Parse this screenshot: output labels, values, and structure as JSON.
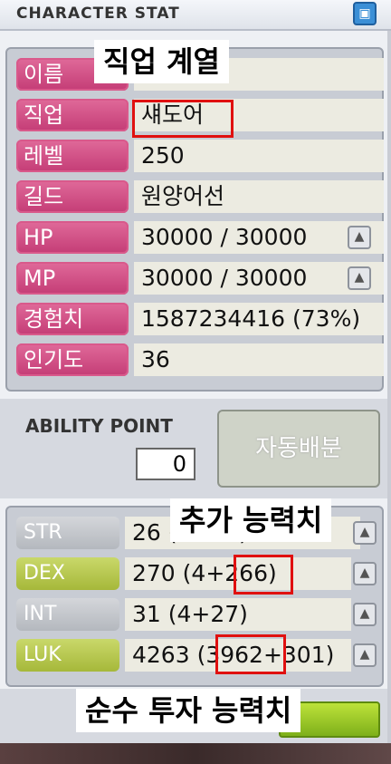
{
  "window": {
    "title": "CHARACTER STAT"
  },
  "stats": [
    {
      "label": "이름",
      "value": "",
      "plus": false
    },
    {
      "label": "직업",
      "value": "섀도어",
      "plus": false
    },
    {
      "label": "레벨",
      "value": "250",
      "plus": false
    },
    {
      "label": "길드",
      "value": "원양어선",
      "plus": false
    },
    {
      "label": "HP",
      "value": "30000 / 30000",
      "plus": true
    },
    {
      "label": "MP",
      "value": "30000 / 30000",
      "plus": true
    },
    {
      "label": "경험치",
      "value": "1587234416 (73%)",
      "plus": false
    },
    {
      "label": "인기도",
      "value": "36",
      "plus": false
    }
  ],
  "ability": {
    "label": "ABILITY POINT",
    "value": "0",
    "auto_button": "자동배분"
  },
  "sub_stats": [
    {
      "label": "STR",
      "value": "26 (4+22)",
      "style": "gray"
    },
    {
      "label": "DEX",
      "value": "270 (4+266)",
      "style": "green"
    },
    {
      "label": "INT",
      "value": "31 (4+27)",
      "style": "gray"
    },
    {
      "label": "LUK",
      "value": "4263 (3962+301)",
      "style": "green"
    }
  ],
  "annotations": {
    "job_line": "직업 계열",
    "extra_stat": "추가 능력치",
    "pure_stat": "순수 투자 능력치"
  },
  "colors": {
    "label_pink": "#c43c76",
    "label_green": "#a6b83a",
    "label_gray": "#b4b8be",
    "highlight_red": "#e01010"
  },
  "icons": {
    "close": "close-icon",
    "plus": "plus-icon"
  }
}
